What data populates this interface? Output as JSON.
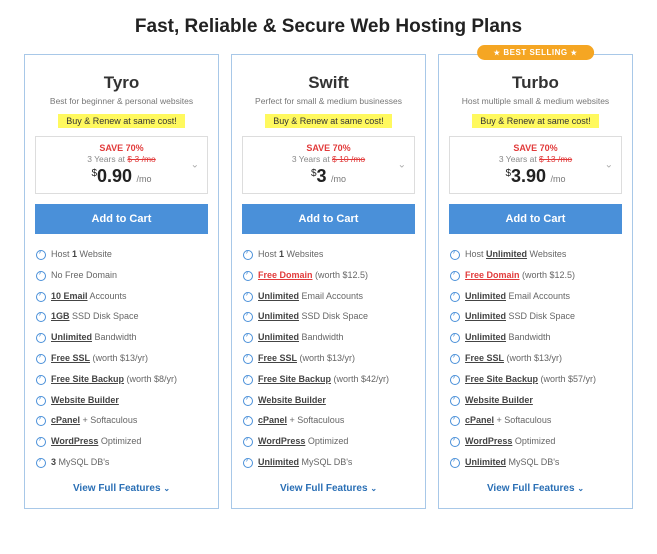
{
  "heading": "Fast, Reliable & Secure Web Hosting Plans",
  "promo": "Buy & Renew at same cost!",
  "plans": [
    {
      "name": "Tyro",
      "desc": "Best for beginner & personal websites",
      "save": "SAVE 70%",
      "term": "3 Years at",
      "old": "$ 3 /mo",
      "cur": "$",
      "amt": "0.90",
      "per": "/mo",
      "cta": "Add to Cart",
      "features": [
        "Host <b>1</b> Website",
        "No Free Domain",
        "<u>10 Email</u> Accounts",
        "<u>1GB</u> SSD Disk Space",
        "<u>Unlimited</u> Bandwidth",
        "<u>Free SSL</u> (worth $13/yr)",
        "<u>Free Site Backup</u> (worth $8/yr)",
        "<u>Website Builder</u>",
        "<u>cPanel</u> + Softaculous",
        "<u>WordPress</u> Optimized",
        "<b>3</b> MySQL DB's"
      ],
      "view": "View Full Features"
    },
    {
      "name": "Swift",
      "desc": "Perfect for small & medium businesses",
      "save": "SAVE 70%",
      "term": "3 Years at",
      "old": "$ 10 /mo",
      "cur": "$",
      "amt": "3",
      "per": "/mo",
      "cta": "Add to Cart",
      "features": [
        "Host <b>1</b> Websites",
        "<span class='red'><u>Free Domain</u></span> (worth $12.5)",
        "<u>Unlimited</u> Email Accounts",
        "<u>Unlimited</u> SSD Disk Space",
        "<u>Unlimited</u> Bandwidth",
        "<u>Free SSL</u> (worth $13/yr)",
        "<u>Free Site Backup</u> (worth $42/yr)",
        "<u>Website Builder</u>",
        "<u>cPanel</u> + Softaculous",
        "<u>WordPress</u> Optimized",
        "<u>Unlimited</u> MySQL DB's"
      ],
      "view": "View Full Features"
    },
    {
      "name": "Turbo",
      "badge": "BEST SELLING",
      "desc": "Host multiple small & medium websites",
      "save": "SAVE 70%",
      "term": "3 Years at",
      "old": "$ 13 /mo",
      "cur": "$",
      "amt": "3.90",
      "per": "/mo",
      "cta": "Add to Cart",
      "features": [
        "Host <u>Unlimited</u> Websites",
        "<span class='red'><u>Free Domain</u></span> (worth $12.5)",
        "<u>Unlimited</u> Email Accounts",
        "<u>Unlimited</u> SSD Disk Space",
        "<u>Unlimited</u> Bandwidth",
        "<u>Free SSL</u> (worth $13/yr)",
        "<u>Free Site Backup</u> (worth $57/yr)",
        "<u>Website Builder</u>",
        "<u>cPanel</u> + Softaculous",
        "<u>WordPress</u> Optimized",
        "<u>Unlimited</u> MySQL DB's"
      ],
      "view": "View Full Features"
    }
  ]
}
